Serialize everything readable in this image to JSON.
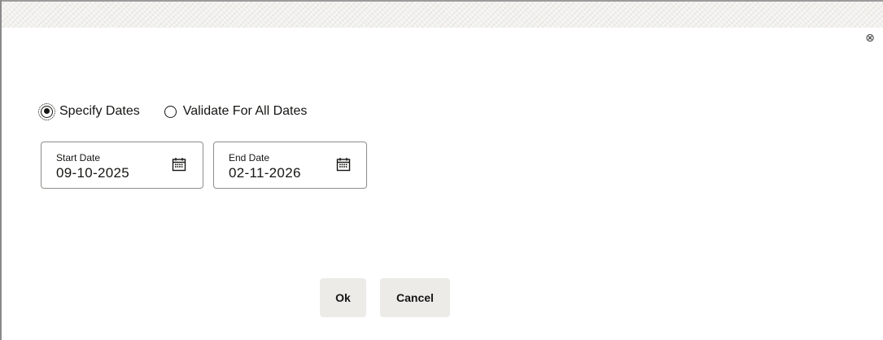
{
  "dialog": {
    "close_icon": "close-circle-icon",
    "close_glyph": "⊗"
  },
  "mode": {
    "options": [
      {
        "label": "Specify Dates",
        "selected": true
      },
      {
        "label": "Validate For All Dates",
        "selected": false
      }
    ]
  },
  "fields": {
    "start_date": {
      "label": "Start Date",
      "value": "09-10-2025",
      "icon": "calendar-icon"
    },
    "end_date": {
      "label": "End Date",
      "value": "02-11-2026",
      "icon": "calendar-icon"
    }
  },
  "actions": {
    "ok_label": "Ok",
    "cancel_label": "Cancel"
  },
  "colors": {
    "text": "#161513",
    "button_bg": "#edebe8",
    "field_border": "#8f8d89",
    "header_bg": "#f2f1ee"
  }
}
